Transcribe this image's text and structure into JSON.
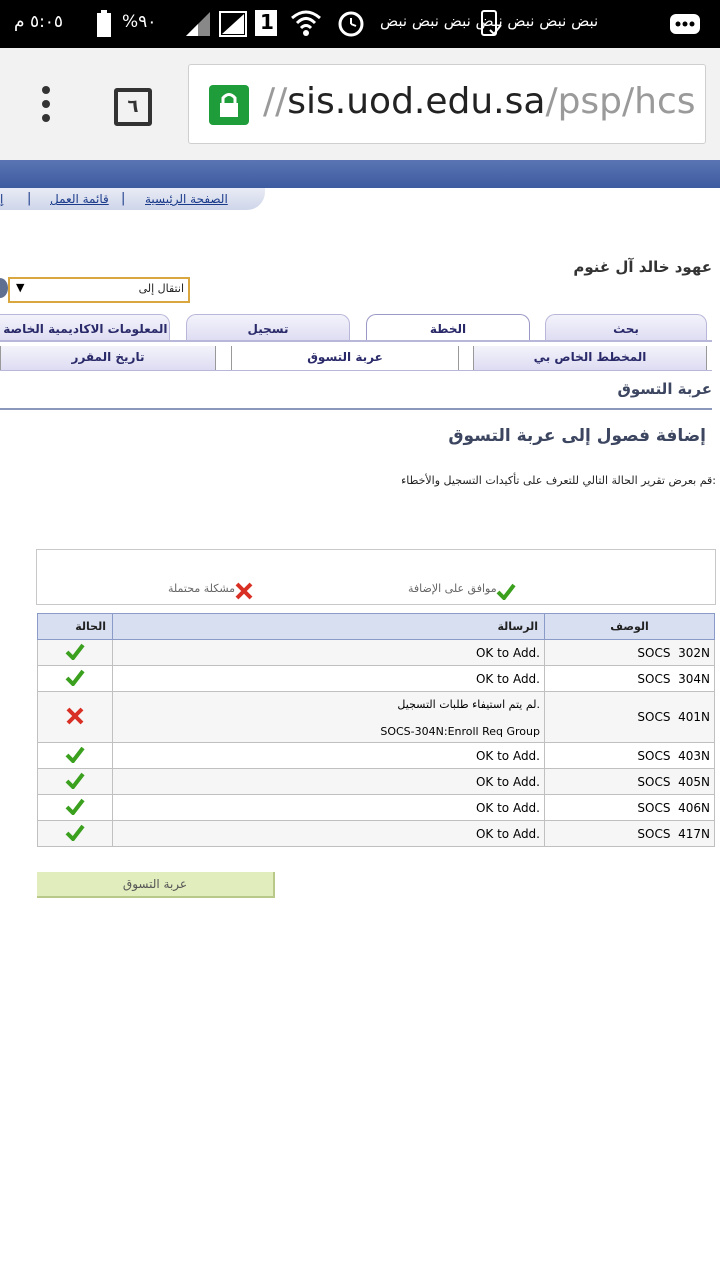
{
  "status_bar": {
    "time": "٥:٠٥ م",
    "battery_percent": "%٩٠",
    "sim_label": "1",
    "notification_text": "نبض نبض نبض نبض نبض نبض نبض"
  },
  "browser": {
    "url_prefix": "//",
    "url_host": "sis.uod.edu.sa",
    "url_path": "/psp/hcs",
    "tab_count": "٦"
  },
  "site_nav": {
    "home": "الصفحة الرئيسية",
    "worklist": "قائمة العمل",
    "extra": "إ"
  },
  "user_name": "عهود خالد آل غنوم",
  "goto_select": {
    "value": "انتقال إلى"
  },
  "tabs_row1": [
    "بحث",
    "الخطة",
    "تسجيل",
    "المعلومات الاكاديمية الخاصة بي"
  ],
  "tabs_row2": [
    "المخطط الخاص بي",
    "عربة التسوق",
    "تاريخ المقرر"
  ],
  "page_title": "عربة التسوق",
  "section_heading": "إضافة فصول إلى عربة التسوق",
  "instructions": "قم بعرض تقرير الحالة التالي للتعرف على تأكيدات التسجيل والأخطاء:",
  "legend": {
    "ok": "موافق على الإضافة",
    "problem": "مشكلة محتملة"
  },
  "table": {
    "headers": {
      "description": "الوصف",
      "message": "الرسالة",
      "status": "الحالة"
    },
    "rows": [
      {
        "description": "SOCS  302N",
        "message": "OK to Add.",
        "status": "ok"
      },
      {
        "description": "SOCS  304N",
        "message": "OK to Add.",
        "status": "ok"
      },
      {
        "description": "SOCS  401N",
        "message": "لم يتم استيفاء طلبات التسجيل.",
        "message2": "SOCS-304N:Enroll Req Group",
        "status": "error"
      },
      {
        "description": "SOCS  403N",
        "message": "OK to Add.",
        "status": "ok"
      },
      {
        "description": "SOCS  405N",
        "message": "OK to Add.",
        "status": "ok"
      },
      {
        "description": "SOCS  406N",
        "message": "OK to Add.",
        "status": "ok"
      },
      {
        "description": "SOCS  417N",
        "message": "OK to Add.",
        "status": "ok"
      }
    ]
  },
  "cart_button": "عربة التسوق",
  "colors": {
    "header_band": "#3e5ba0",
    "ok_green": "#3aa01e",
    "error_red": "#d93025",
    "cart_button": "#e1edbd"
  }
}
